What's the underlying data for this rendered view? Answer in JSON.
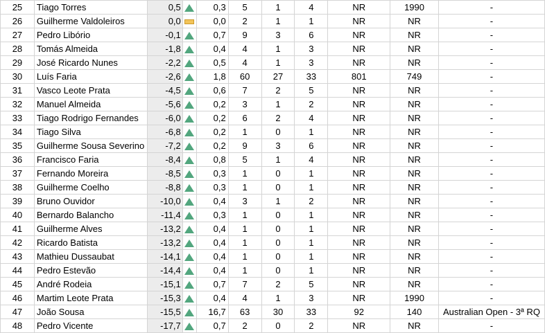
{
  "colors": {
    "up": "#52a67e",
    "flat": "#f2c45a",
    "shaded": "#ececec",
    "grid": "#d4d4d4"
  },
  "rows": [
    {
      "pos": "25",
      "name": "Tiago Torres",
      "diff": "0,5",
      "trend": "up",
      "ratio": "0,3",
      "c1": "5",
      "c2": "1",
      "c3": "4",
      "r1": "NR",
      "r2": "1990",
      "note": "-"
    },
    {
      "pos": "26",
      "name": "Guilherme Valdoleiros",
      "diff": "0,0",
      "trend": "flat",
      "ratio": "0,0",
      "c1": "2",
      "c2": "1",
      "c3": "1",
      "r1": "NR",
      "r2": "NR",
      "note": "-"
    },
    {
      "pos": "27",
      "name": "Pedro Libório",
      "diff": "-0,1",
      "trend": "up",
      "ratio": "0,7",
      "c1": "9",
      "c2": "3",
      "c3": "6",
      "r1": "NR",
      "r2": "NR",
      "note": "-"
    },
    {
      "pos": "28",
      "name": "Tomás Almeida",
      "diff": "-1,8",
      "trend": "up",
      "ratio": "0,4",
      "c1": "4",
      "c2": "1",
      "c3": "3",
      "r1": "NR",
      "r2": "NR",
      "note": "-"
    },
    {
      "pos": "29",
      "name": "José Ricardo Nunes",
      "diff": "-2,2",
      "trend": "up",
      "ratio": "0,5",
      "c1": "4",
      "c2": "1",
      "c3": "3",
      "r1": "NR",
      "r2": "NR",
      "note": "-"
    },
    {
      "pos": "30",
      "name": "Luís Faria",
      "diff": "-2,6",
      "trend": "up",
      "ratio": "1,8",
      "c1": "60",
      "c2": "27",
      "c3": "33",
      "r1": "801",
      "r2": "749",
      "note": "-"
    },
    {
      "pos": "31",
      "name": "Vasco Leote Prata",
      "diff": "-4,5",
      "trend": "up",
      "ratio": "0,6",
      "c1": "7",
      "c2": "2",
      "c3": "5",
      "r1": "NR",
      "r2": "NR",
      "note": "-"
    },
    {
      "pos": "32",
      "name": "Manuel Almeida",
      "diff": "-5,6",
      "trend": "up",
      "ratio": "0,2",
      "c1": "3",
      "c2": "1",
      "c3": "2",
      "r1": "NR",
      "r2": "NR",
      "note": "-"
    },
    {
      "pos": "33",
      "name": "Tiago Rodrigo Fernandes",
      "diff": "-6,0",
      "trend": "up",
      "ratio": "0,2",
      "c1": "6",
      "c2": "2",
      "c3": "4",
      "r1": "NR",
      "r2": "NR",
      "note": "-"
    },
    {
      "pos": "34",
      "name": "Tiago Silva",
      "diff": "-6,8",
      "trend": "up",
      "ratio": "0,2",
      "c1": "1",
      "c2": "0",
      "c3": "1",
      "r1": "NR",
      "r2": "NR",
      "note": "-"
    },
    {
      "pos": "35",
      "name": "Guilherme Sousa Severino",
      "diff": "-7,2",
      "trend": "up",
      "ratio": "0,2",
      "c1": "9",
      "c2": "3",
      "c3": "6",
      "r1": "NR",
      "r2": "NR",
      "note": "-"
    },
    {
      "pos": "36",
      "name": "Francisco Faria",
      "diff": "-8,4",
      "trend": "up",
      "ratio": "0,8",
      "c1": "5",
      "c2": "1",
      "c3": "4",
      "r1": "NR",
      "r2": "NR",
      "note": "-"
    },
    {
      "pos": "37",
      "name": "Fernando Moreira",
      "diff": "-8,5",
      "trend": "up",
      "ratio": "0,3",
      "c1": "1",
      "c2": "0",
      "c3": "1",
      "r1": "NR",
      "r2": "NR",
      "note": "-"
    },
    {
      "pos": "38",
      "name": "Guilherme Coelho",
      "diff": "-8,8",
      "trend": "up",
      "ratio": "0,3",
      "c1": "1",
      "c2": "0",
      "c3": "1",
      "r1": "NR",
      "r2": "NR",
      "note": "-"
    },
    {
      "pos": "39",
      "name": "Bruno Ouvidor",
      "diff": "-10,0",
      "trend": "up",
      "ratio": "0,4",
      "c1": "3",
      "c2": "1",
      "c3": "2",
      "r1": "NR",
      "r2": "NR",
      "note": "-"
    },
    {
      "pos": "40",
      "name": "Bernardo Balancho",
      "diff": "-11,4",
      "trend": "up",
      "ratio": "0,3",
      "c1": "1",
      "c2": "0",
      "c3": "1",
      "r1": "NR",
      "r2": "NR",
      "note": "-"
    },
    {
      "pos": "41",
      "name": "Guilherme Alves",
      "diff": "-13,2",
      "trend": "up",
      "ratio": "0,4",
      "c1": "1",
      "c2": "0",
      "c3": "1",
      "r1": "NR",
      "r2": "NR",
      "note": "-"
    },
    {
      "pos": "42",
      "name": "Ricardo Batista",
      "diff": "-13,2",
      "trend": "up",
      "ratio": "0,4",
      "c1": "1",
      "c2": "0",
      "c3": "1",
      "r1": "NR",
      "r2": "NR",
      "note": "-"
    },
    {
      "pos": "43",
      "name": "Mathieu Dussaubat",
      "diff": "-14,1",
      "trend": "up",
      "ratio": "0,4",
      "c1": "1",
      "c2": "0",
      "c3": "1",
      "r1": "NR",
      "r2": "NR",
      "note": "-"
    },
    {
      "pos": "44",
      "name": "Pedro Estevão",
      "diff": "-14,4",
      "trend": "up",
      "ratio": "0,4",
      "c1": "1",
      "c2": "0",
      "c3": "1",
      "r1": "NR",
      "r2": "NR",
      "note": "-"
    },
    {
      "pos": "45",
      "name": "André Rodeia",
      "diff": "-15,1",
      "trend": "up",
      "ratio": "0,7",
      "c1": "7",
      "c2": "2",
      "c3": "5",
      "r1": "NR",
      "r2": "NR",
      "note": "-"
    },
    {
      "pos": "46",
      "name": "Martim Leote Prata",
      "diff": "-15,3",
      "trend": "up",
      "ratio": "0,4",
      "c1": "4",
      "c2": "1",
      "c3": "3",
      "r1": "NR",
      "r2": "1990",
      "note": "-"
    },
    {
      "pos": "47",
      "name": "João Sousa",
      "diff": "-15,5",
      "trend": "up",
      "ratio": "16,7",
      "c1": "63",
      "c2": "30",
      "c3": "33",
      "r1": "92",
      "r2": "140",
      "note": "Australian Open - 3ª RQ"
    },
    {
      "pos": "48",
      "name": "Pedro Vicente",
      "diff": "-17,7",
      "trend": "up",
      "ratio": "0,7",
      "c1": "2",
      "c2": "0",
      "c3": "2",
      "r1": "NR",
      "r2": "NR",
      "note": "-"
    }
  ]
}
